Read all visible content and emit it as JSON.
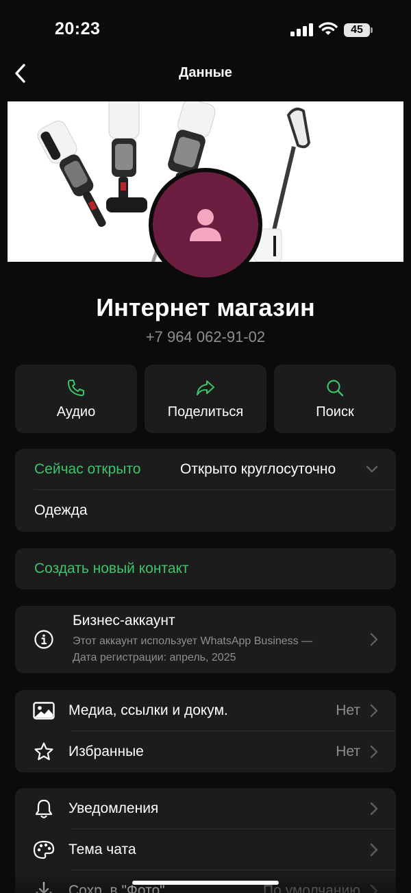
{
  "status_bar": {
    "time": "20:23",
    "battery": "45"
  },
  "nav": {
    "title": "Данные"
  },
  "profile": {
    "name": "Интернет магазин",
    "phone": "+7 964 062-91-02"
  },
  "actions": [
    {
      "label": "Аудио",
      "icon": "phone-icon"
    },
    {
      "label": "Поделиться",
      "icon": "share-icon"
    },
    {
      "label": "Поиск",
      "icon": "search-icon"
    }
  ],
  "hours": {
    "status": "Сейчас открыто",
    "schedule": "Открыто круглосуточно",
    "category": "Одежда"
  },
  "create_contact": "Создать новый контакт",
  "business": {
    "title": "Бизнес-аккаунт",
    "line1": "Этот аккаунт использует WhatsApp Business —",
    "line2": "Дата регистрации: апрель, 2025"
  },
  "media": {
    "items": [
      {
        "label": "Медиа, ссылки и докум.",
        "value": "Нет",
        "icon": "image-icon"
      },
      {
        "label": "Избранные",
        "value": "Нет",
        "icon": "star-icon"
      }
    ]
  },
  "settings": {
    "items": [
      {
        "label": "Уведомления",
        "icon": "bell-icon"
      },
      {
        "label": "Тема чата",
        "icon": "palette-icon"
      },
      {
        "label": "Сохр. в \"Фото\"",
        "value": "По умолчанию",
        "icon": "download-icon"
      }
    ]
  },
  "colors": {
    "accent": "#3cc46a",
    "avatar_bg": "#6b1d40",
    "avatar_fg": "#f4a6c1",
    "card_bg": "#1c1c1c",
    "page_bg": "#0b0b0b"
  }
}
